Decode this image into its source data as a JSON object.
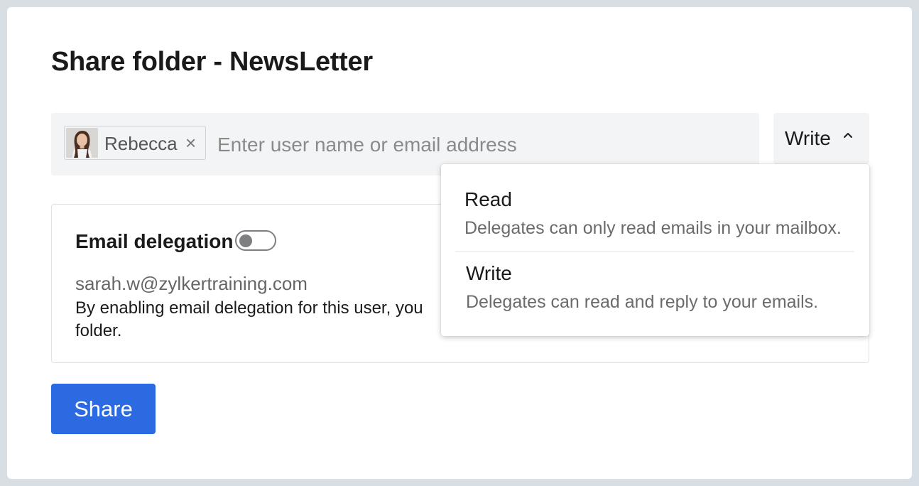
{
  "dialog": {
    "title": "Share folder - NewsLetter"
  },
  "recipients": {
    "chips": [
      {
        "name": "Rebecca",
        "remove_glyph": "×",
        "avatar_icon": "user-avatar-photo"
      }
    ],
    "input_placeholder": "Enter user name or email address",
    "input_value": ""
  },
  "permission": {
    "selected": "Write",
    "chevron_icon": "chevron-up-icon",
    "options": [
      {
        "label": "Read",
        "description": "Delegates can only read emails in your mailbox."
      },
      {
        "label": "Write",
        "description": "Delegates can read and reply to your emails."
      }
    ]
  },
  "delegation": {
    "title": "Email delegation",
    "enabled": false,
    "email": "sarah.w@zylkertraining.com",
    "description": "By enabling email delegation for this user, you",
    "description_line2": "folder."
  },
  "actions": {
    "share_label": "Share",
    "share_color": "#2b6ae0"
  }
}
